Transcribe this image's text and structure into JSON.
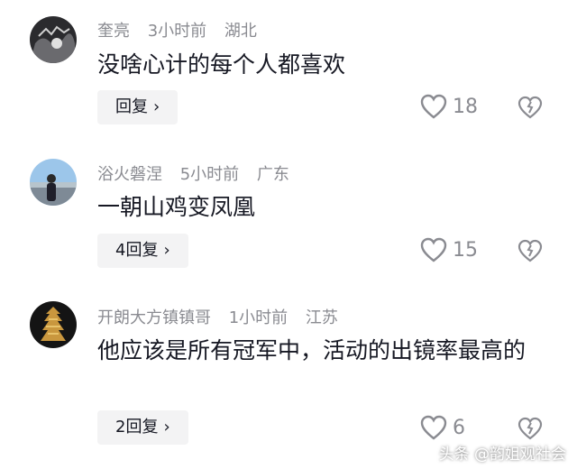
{
  "comments": [
    {
      "username": "奎亮",
      "time": "3小时前",
      "location": "湖北",
      "text": "没啥心计的每个人都喜欢",
      "reply_label": "回复",
      "likes": "18"
    },
    {
      "username": "浴火磐涅",
      "time": "5小时前",
      "location": "广东",
      "text": "一朝山鸡变凤凰",
      "reply_label": "4回复",
      "likes": "15"
    },
    {
      "username": "开朗大方镇镇哥",
      "time": "1小时前",
      "location": "江苏",
      "text": "他应该是所有冠军中，活动的出镜率最高的",
      "reply_label": "2回复",
      "likes": "6"
    }
  ],
  "watermark": "头条 @韵姐观社会",
  "icons": [
    "heart-icon",
    "broken-heart-icon",
    "chevron-right-icon"
  ]
}
